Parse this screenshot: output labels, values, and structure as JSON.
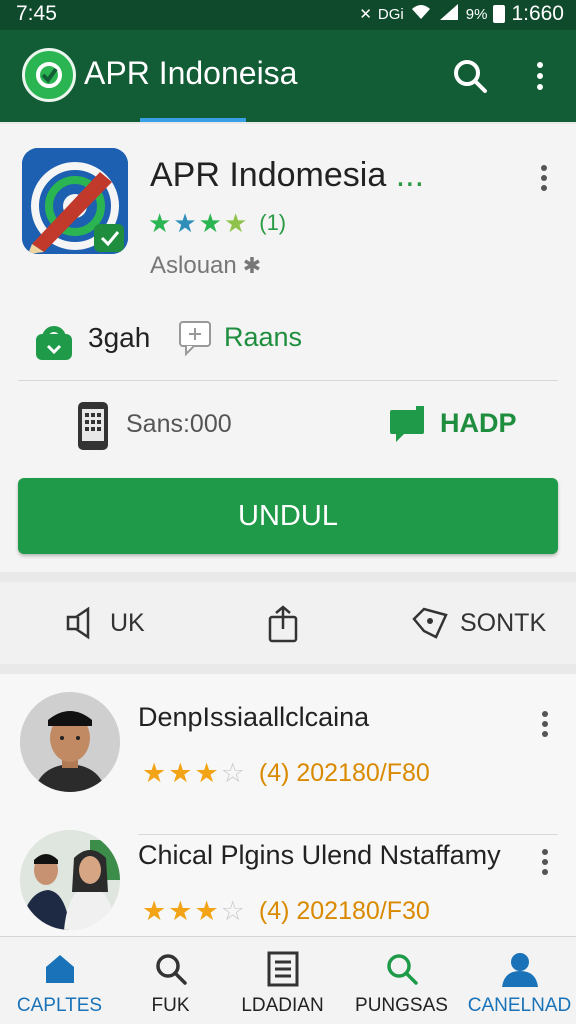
{
  "status_bar": {
    "time": "7:45",
    "network": "DGi",
    "battery_pct": "9%",
    "right_time": "1:660"
  },
  "header": {
    "title": "APR Indoneisa",
    "icons": [
      "app-logo-icon",
      "search-icon",
      "more-vert-icon"
    ]
  },
  "app": {
    "name": "APR Indomesia",
    "name_suffix": "...",
    "rating_stars": 3.5,
    "rating_count": "(1)",
    "developer": "Aslouan",
    "download_size": "3gah",
    "rating_label": "Raans",
    "compat_label": "Sans:000",
    "hadp_label": "HADP",
    "install_label": "UNDUL"
  },
  "actions": [
    {
      "label": "UK",
      "icon": "speaker-icon"
    },
    {
      "label": "",
      "icon": "share-icon"
    },
    {
      "label": "SONTK",
      "icon": "tag-icon"
    }
  ],
  "reviews": [
    {
      "name": "DenpIssiaallclcaina",
      "stars": 3,
      "meta": "(4) 202180/F80"
    },
    {
      "name": "Chical Plgins Ulend Nstaffamy",
      "stars": 3,
      "meta": "(4) 202180/F30"
    }
  ],
  "bottom_nav": [
    {
      "label": "CAPLTES",
      "icon": "home-icon",
      "active": true
    },
    {
      "label": "FUK",
      "icon": "search-icon",
      "active": false
    },
    {
      "label": "LDADIAN",
      "icon": "document-icon",
      "active": false
    },
    {
      "label": "PUNGSAS",
      "icon": "search-icon",
      "active": false
    },
    {
      "label": "CANELNAD",
      "icon": "person-icon",
      "active": true
    }
  ],
  "colors": {
    "primary_dark": "#0f4a2c",
    "primary": "#125c36",
    "accent_green": "#1f9a48",
    "star_orange": "#f2a316",
    "nav_active": "#1a73b8"
  }
}
